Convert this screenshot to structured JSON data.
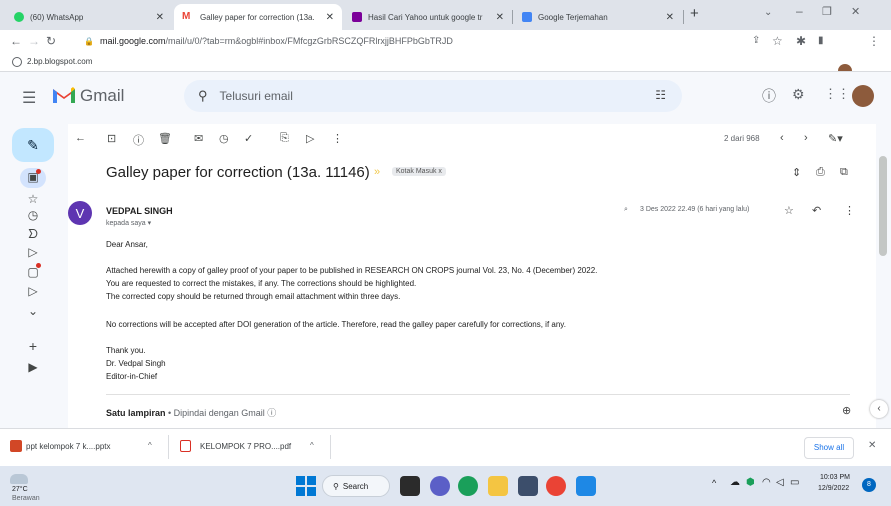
{
  "browser": {
    "tabs": [
      {
        "title": "(60) WhatsApp",
        "color": "#25d366"
      },
      {
        "title": "Galley paper for correction (13a.",
        "color": "#ea4335"
      },
      {
        "title": "Hasil Cari Yahoo untuk google tr",
        "color": "#7b0099"
      },
      {
        "title": "Google Terjemahan",
        "color": "#4285f4"
      }
    ],
    "url_domain": "mail.google.com",
    "url_path": "/mail/u/0/?tab=rm&ogbl#inbox/FMfcgzGrbRSCZQFRlrxjjBHFPbGbTRJD",
    "bookmark": "2.bp.blogspot.com"
  },
  "gmail": {
    "logo_text": "Gmail",
    "search_placeholder": "Telusuri email",
    "pager": "2 dari 968",
    "subject": "Galley paper for correction (13a. 11146)",
    "label": "Kotak Masuk",
    "label_x": "x",
    "sender_initial": "V",
    "sender": "VEDPAL SINGH",
    "to": "kepada saya",
    "date": "3 Des 2022 22.49 (6 hari yang lalu)",
    "body": [
      "Dear Ansar,",
      "Attached herewith a copy of galley proof of  your paper to be  published in  RESEARCH ON CROPS journal Vol. 23, No. 4 (December) 2022.",
      "You are requested to correct the mistakes, if any. The corrections should be highlighted.",
      "The corrected copy should be returned through email attachment within three days.",
      "No corrections will be accepted after DOI generation of the article. Therefore, read the galley paper carefully for corrections, if any.",
      "Thank you.",
      "Dr. Vedpal Singh",
      "Editor-in-Chief"
    ],
    "attachment_title": "Satu lampiran",
    "attachment_note": " • Dipindai dengan Gmail ⓘ"
  },
  "downloads": {
    "items": [
      "ppt kelompok 7 k....pptx",
      "KELOMPOK 7 PRO....pdf"
    ],
    "show_all": "Show all"
  },
  "taskbar": {
    "temp": "27°C",
    "weather": "Berawan",
    "search": "Search",
    "time": "10:03 PM",
    "date": "12/9/2022",
    "badge": "8"
  }
}
